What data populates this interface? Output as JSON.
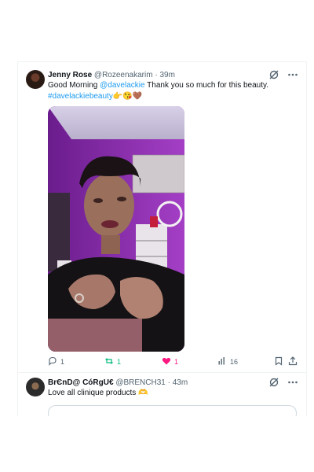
{
  "tweets": [
    {
      "author_name": "Jenny Rose",
      "handle": "@Rozeenakarim",
      "separator": "·",
      "time": "39m",
      "text_prefix": "Good Morning ",
      "mention": "@davelackie",
      "text_suffix": " Thank you so much for this beauty.",
      "hashtag": "#davelackiebeauty",
      "emojis": "👉😘🤎",
      "actions": {
        "replies": "1",
        "retweets": "1",
        "likes": "1",
        "views": "16"
      }
    },
    {
      "author_name": "BrЄnD@ CóRgU€",
      "handle": "@BRENCH31",
      "separator": "·",
      "time": "43m",
      "text": "Love all clinique products",
      "emojis": "🫶"
    }
  ],
  "icons": {
    "grok": "grok-icon",
    "more": "more-icon",
    "reply": "reply-icon",
    "retweet": "retweet-icon",
    "like": "heart-icon",
    "views": "views-icon",
    "bookmark": "bookmark-icon",
    "share": "share-icon"
  },
  "colors": {
    "link": "#1d9bf0",
    "retweet": "#00ba7c",
    "like": "#f91880",
    "muted": "#536471"
  }
}
